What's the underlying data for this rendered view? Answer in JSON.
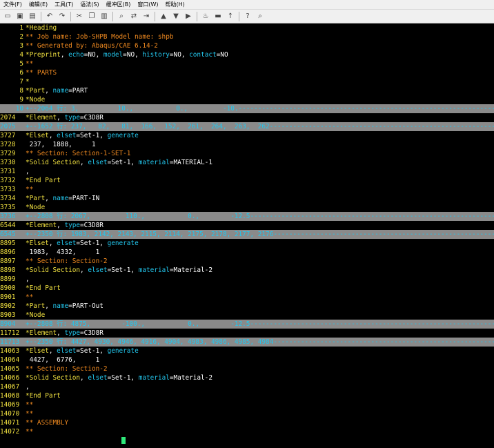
{
  "menubar": {
    "items": [
      "文件(F)",
      "编辑(E)",
      "工具(T)",
      "语法(S)",
      "缓冲区(B)",
      "窗口(W)",
      "帮助(H)"
    ]
  },
  "toolbar": {
    "icons": [
      "open-icon",
      "save-icon",
      "print-icon",
      "undo-icon",
      "redo-icon",
      "cut-icon",
      "copy-icon",
      "paste-icon",
      "find-icon",
      "replace-icon",
      "find-next-icon",
      "load-session-icon",
      "save-session-icon",
      "run-script-icon",
      "make-icon",
      "shell-icon",
      "tags-icon",
      "help-icon",
      "find-help-icon"
    ]
  },
  "editor": {
    "lines": [
      {
        "num": "1",
        "type": "normal",
        "segs": [
          [
            "*Heading",
            "yellow"
          ]
        ]
      },
      {
        "num": "2",
        "type": "normal",
        "segs": [
          [
            "** Job name: Job-SHPB Model name: shpb",
            "orange"
          ]
        ]
      },
      {
        "num": "3",
        "type": "normal",
        "segs": [
          [
            "** Generated by: Abaqus/CAE 6.14-2",
            "orange"
          ]
        ]
      },
      {
        "num": "4",
        "type": "normal",
        "segs": [
          [
            "*Preprint",
            "yellow"
          ],
          [
            ", ",
            "white"
          ],
          [
            "echo",
            "cyan"
          ],
          [
            "=NO, ",
            "white"
          ],
          [
            "model",
            "cyan"
          ],
          [
            "=NO, ",
            "white"
          ],
          [
            "history",
            "cyan"
          ],
          [
            "=NO, ",
            "white"
          ],
          [
            "contact",
            "cyan"
          ],
          [
            "=NO",
            "white"
          ]
        ]
      },
      {
        "num": "5",
        "type": "normal",
        "segs": [
          [
            "**",
            "orange"
          ]
        ]
      },
      {
        "num": "6",
        "type": "normal",
        "segs": [
          [
            "** PARTS",
            "orange"
          ]
        ]
      },
      {
        "num": "7",
        "type": "normal",
        "segs": [
          [
            "*",
            "yellow"
          ]
        ]
      },
      {
        "num": "8",
        "type": "normal",
        "segs": [
          [
            "*Part",
            "yellow"
          ],
          [
            ", ",
            "white"
          ],
          [
            "name",
            "cyan"
          ],
          [
            "=PART",
            "white"
          ]
        ]
      },
      {
        "num": "9",
        "type": "normal",
        "segs": [
          [
            "*Node",
            "yellow"
          ]
        ]
      },
      {
        "num": "10",
        "type": "folded",
        "text": "+--2064 行: 3,          10.,           0.,         -10.----------------------------------------------------------------------------------------"
      },
      {
        "num": "2074",
        "type": "wide",
        "segs": [
          [
            "*Element",
            "yellow"
          ],
          [
            ", ",
            "white"
          ],
          [
            "type",
            "cyan"
          ],
          [
            "=C3D8R",
            "white"
          ]
        ]
      },
      {
        "num": "2075",
        "type": "folded-wide",
        "text": "+--1652 行: 237,   82,   81,  166,  152,  261,  264,  263,  262---------------------------------------------------------------------------"
      },
      {
        "num": "3727",
        "type": "wide",
        "segs": [
          [
            "*Elset",
            "yellow"
          ],
          [
            ", ",
            "white"
          ],
          [
            "elset",
            "cyan"
          ],
          [
            "=Set-1, ",
            "white"
          ],
          [
            "generate",
            "cyan"
          ]
        ]
      },
      {
        "num": "3728",
        "type": "wide",
        "segs": [
          [
            " 237,  1888,     1",
            "white"
          ]
        ]
      },
      {
        "num": "3729",
        "type": "wide",
        "segs": [
          [
            "** Section: Section-1-SET-1",
            "orange"
          ]
        ]
      },
      {
        "num": "3730",
        "type": "wide",
        "segs": [
          [
            "*Solid Section",
            "yellow"
          ],
          [
            ", ",
            "white"
          ],
          [
            "elset",
            "cyan"
          ],
          [
            "=Set-1, ",
            "white"
          ],
          [
            "material",
            "cyan"
          ],
          [
            "=MATERIAL-1",
            "white"
          ]
        ]
      },
      {
        "num": "3731",
        "type": "wide",
        "segs": [
          [
            ",",
            "white"
          ]
        ]
      },
      {
        "num": "3732",
        "type": "wide",
        "segs": [
          [
            "*End Part",
            "yellow"
          ]
        ]
      },
      {
        "num": "3733",
        "type": "wide",
        "segs": [
          [
            "**",
            "orange"
          ]
        ]
      },
      {
        "num": "3734",
        "type": "wide",
        "segs": [
          [
            "*Part",
            "yellow"
          ],
          [
            ", ",
            "white"
          ],
          [
            "name",
            "cyan"
          ],
          [
            "=PART-IN",
            "white"
          ]
        ]
      },
      {
        "num": "3735",
        "type": "wide",
        "segs": [
          [
            "*Node",
            "yellow"
          ]
        ]
      },
      {
        "num": "3736",
        "type": "folded-wide",
        "text": "+--2808 行: 2067,         110.,           0.,        -12.5---------------------------------------------------------------------------------"
      },
      {
        "num": "6544",
        "type": "wide",
        "segs": [
          [
            "*Element",
            "yellow"
          ],
          [
            ", ",
            "white"
          ],
          [
            "type",
            "cyan"
          ],
          [
            "=C3D8R",
            "white"
          ]
        ]
      },
      {
        "num": "6545",
        "type": "folded-wide",
        "text": "+--2350 行: 1983, 2142, 2143, 2115, 2114, 2175, 2178, 2177, 2176---------------------------------------------------------------------"
      },
      {
        "num": "8895",
        "type": "wide",
        "segs": [
          [
            "*Elset",
            "yellow"
          ],
          [
            ", ",
            "white"
          ],
          [
            "elset",
            "cyan"
          ],
          [
            "=Set-1, ",
            "white"
          ],
          [
            "generate",
            "cyan"
          ]
        ]
      },
      {
        "num": "8896",
        "type": "wide",
        "segs": [
          [
            " 1983,  4332,     1",
            "white"
          ]
        ]
      },
      {
        "num": "8897",
        "type": "wide",
        "segs": [
          [
            "** Section: Section-2",
            "orange"
          ]
        ]
      },
      {
        "num": "8898",
        "type": "wide",
        "segs": [
          [
            "*Solid Section",
            "yellow"
          ],
          [
            ", ",
            "white"
          ],
          [
            "elset",
            "cyan"
          ],
          [
            "=Set-1, ",
            "white"
          ],
          [
            "material",
            "cyan"
          ],
          [
            "=Material-2",
            "white"
          ]
        ]
      },
      {
        "num": "8899",
        "type": "wide",
        "segs": [
          [
            ",",
            "white"
          ]
        ]
      },
      {
        "num": "8900",
        "type": "wide",
        "segs": [
          [
            "*End Part",
            "yellow"
          ]
        ]
      },
      {
        "num": "8901",
        "type": "wide",
        "segs": [
          [
            "**",
            "orange"
          ]
        ]
      },
      {
        "num": "8902",
        "type": "wide",
        "segs": [
          [
            "*Part",
            "yellow"
          ],
          [
            ", ",
            "white"
          ],
          [
            "name",
            "cyan"
          ],
          [
            "=PART-Out",
            "white"
          ]
        ]
      },
      {
        "num": "8903",
        "type": "wide",
        "segs": [
          [
            "*Node",
            "yellow"
          ]
        ]
      },
      {
        "num": "8904",
        "type": "folded-wide",
        "text": "+--2808 行: 4875,        -100.,           0.,        -12.5---------------------------------------------------------------------------------"
      },
      {
        "num": "11712",
        "type": "wide",
        "segs": [
          [
            "*Element",
            "yellow"
          ],
          [
            ", ",
            "white"
          ],
          [
            "type",
            "cyan"
          ],
          [
            "=C3D8R",
            "white"
          ]
        ]
      },
      {
        "num": "11713",
        "type": "folded-wide",
        "text": "+--2350 行: 4427, 4930, 4946, 4916, 4904, 4983, 4986, 4985, 4984---------------------------------------------------------------------"
      },
      {
        "num": "14063",
        "type": "wide",
        "segs": [
          [
            "*Elset",
            "yellow"
          ],
          [
            ", ",
            "white"
          ],
          [
            "elset",
            "cyan"
          ],
          [
            "=Set-1, ",
            "white"
          ],
          [
            "generate",
            "cyan"
          ]
        ]
      },
      {
        "num": "14064",
        "type": "wide",
        "segs": [
          [
            " 4427,  6776,     1",
            "white"
          ]
        ]
      },
      {
        "num": "14065",
        "type": "wide",
        "segs": [
          [
            "** Section: Section-2",
            "orange"
          ]
        ]
      },
      {
        "num": "14066",
        "type": "wide",
        "segs": [
          [
            "*Solid Section",
            "yellow"
          ],
          [
            ", ",
            "white"
          ],
          [
            "elset",
            "cyan"
          ],
          [
            "=Set-1, ",
            "white"
          ],
          [
            "material",
            "cyan"
          ],
          [
            "=Material-2",
            "white"
          ]
        ]
      },
      {
        "num": "14067",
        "type": "wide",
        "segs": [
          [
            ",",
            "white"
          ]
        ]
      },
      {
        "num": "14068",
        "type": "wide",
        "segs": [
          [
            "*End Part",
            "yellow"
          ]
        ]
      },
      {
        "num": "14069",
        "type": "wide",
        "segs": [
          [
            "**",
            "orange"
          ]
        ]
      },
      {
        "num": "14070",
        "type": "wide",
        "segs": [
          [
            "**",
            "orange"
          ]
        ]
      },
      {
        "num": "14071",
        "type": "wide",
        "segs": [
          [
            "** ASSEMBLY",
            "orange"
          ]
        ]
      },
      {
        "num": "14072",
        "type": "wide",
        "segs": [
          [
            "**",
            "orange"
          ]
        ]
      }
    ]
  },
  "colors": {
    "background": "#000000",
    "line_number": "#f0e040",
    "keyword": "#f0e040",
    "comment": "#f08a20",
    "attribute": "#23c7ee",
    "fold_background": "#8a8a8a",
    "cursor": "#2ee87a"
  }
}
